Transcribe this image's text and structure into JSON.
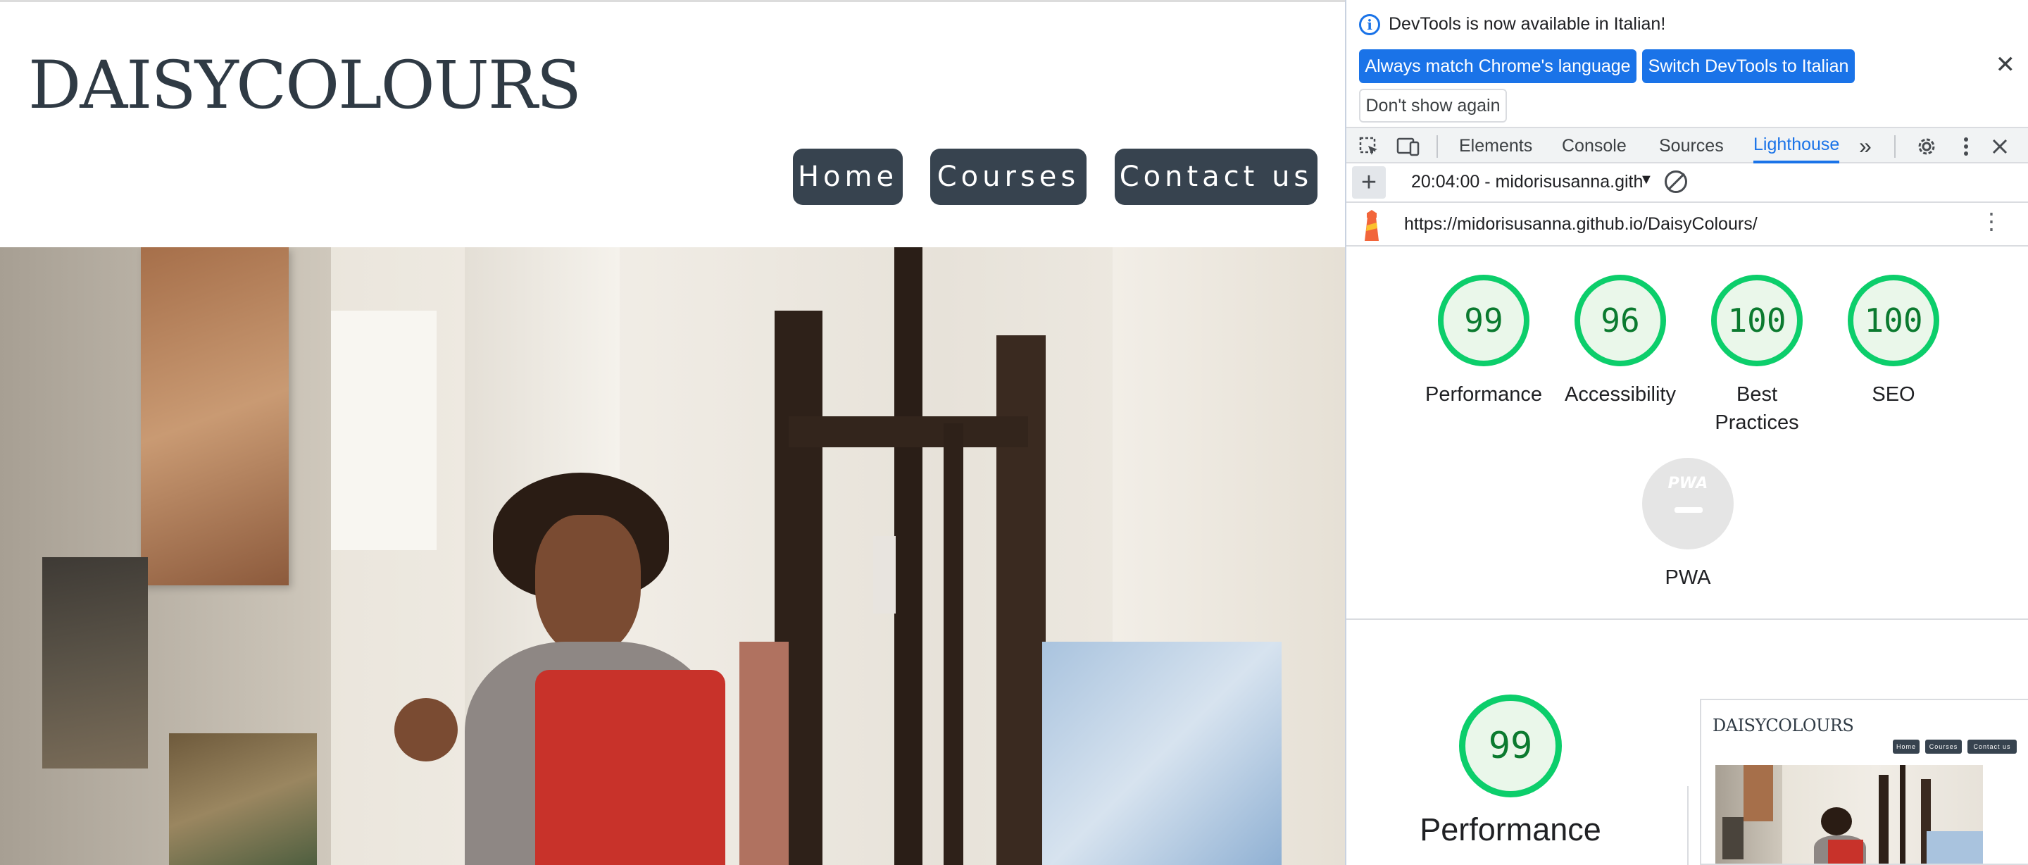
{
  "site": {
    "logo": "DAISYCOLOURS",
    "nav": [
      "Home",
      "Courses",
      "Contact us"
    ]
  },
  "devtools": {
    "infobar": {
      "message": "DevTools is now available in Italian!",
      "match_language": "Always match Chrome's language",
      "switch_language": "Switch DevTools to Italian",
      "dont_show": "Don't show again",
      "close": "✕"
    },
    "tabs": [
      "Elements",
      "Console",
      "Sources",
      "Lighthouse"
    ],
    "active_tab": "Lighthouse",
    "more_tabs": "»",
    "report": {
      "selected": "20:04:00 - midorisusanna.gith",
      "url": "https://midorisusanna.github.io/DaisyColours/"
    },
    "scores": [
      {
        "label": "Performance",
        "value": "99"
      },
      {
        "label": "Accessibility",
        "value": "96"
      },
      {
        "label": "Best Practices",
        "value": "100"
      },
      {
        "label": "SEO",
        "value": "100"
      }
    ],
    "pwa": {
      "badge": "PWA",
      "label": "PWA"
    },
    "detail": {
      "score": "99",
      "label": "Performance"
    },
    "thumbnail": {
      "logo": "DAISYCOLOURS",
      "nav": [
        "Home",
        "Courses",
        "Contact us"
      ]
    },
    "colors": {
      "accent": "#1a73e8",
      "pass": "#0cce6b",
      "nav_bg": "#37434f"
    }
  }
}
